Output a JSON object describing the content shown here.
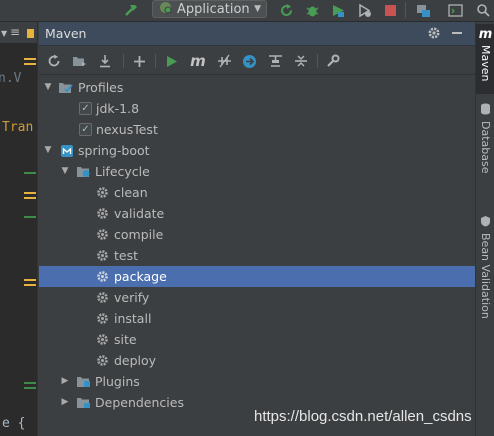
{
  "toolbar": {
    "run_config_label": "Application",
    "icons": [
      "build-hammer-icon",
      "run-config-dropdown",
      "rerun-icon",
      "debug-bug-icon",
      "run-with-coverage-icon",
      "profile-icon",
      "stop-icon",
      "project-structure-icon",
      "terminal-icon",
      "search-icon"
    ]
  },
  "editor": {
    "tab_label": "≡",
    "fragments": [
      "n.V",
      "Tran",
      "e {"
    ]
  },
  "maven": {
    "title": "Maven",
    "toolbar_icons": [
      "reimport-icon",
      "generate-sources-icon",
      "download-icon",
      "add-icon",
      "run-icon",
      "execute-goal-icon",
      "toggle-offline-icon",
      "skip-tests-icon",
      "show-dependencies-icon",
      "collapse-all-icon",
      "settings-wrench-icon"
    ],
    "execute_goal_glyph": "m",
    "tree": {
      "profiles_label": "Profiles",
      "profiles": [
        {
          "label": "jdk-1.8",
          "checked": true
        },
        {
          "label": "nexusTest",
          "checked": true
        }
      ],
      "project_label": "spring-boot",
      "lifecycle_label": "Lifecycle",
      "lifecycle": [
        "clean",
        "validate",
        "compile",
        "test",
        "package",
        "verify",
        "install",
        "site",
        "deploy"
      ],
      "selected": "package",
      "plugins_label": "Plugins",
      "dependencies_label": "Dependencies"
    }
  },
  "sidebar": {
    "tabs": [
      {
        "label": "Maven",
        "active": true
      },
      {
        "label": "Database",
        "active": false
      },
      {
        "label": "Bean Validation",
        "active": false
      }
    ],
    "maven_glyph": "m"
  },
  "watermark": "https://blog.csdn.net/allen_csdns",
  "colors": {
    "background": "#3c3f41",
    "editor": "#2b2b2b",
    "selection": "#4b6eaf",
    "header": "#3d4b5c",
    "run_green": "#499c54",
    "stop_red": "#c75450",
    "folder_blue": "#87939a",
    "accent_blue": "#3592c4"
  }
}
